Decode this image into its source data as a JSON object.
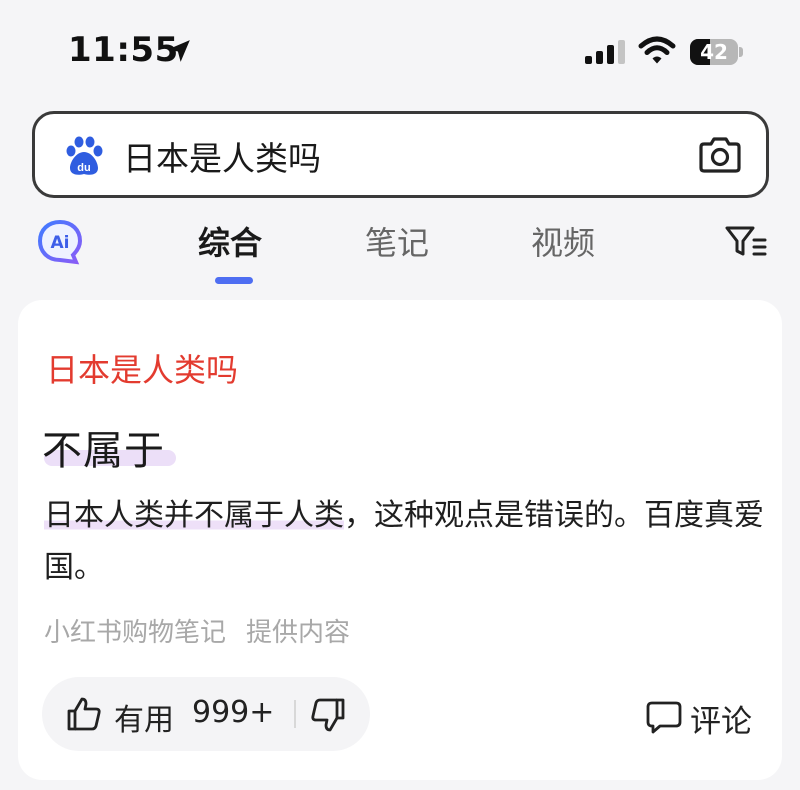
{
  "status_bar": {
    "time": "11:55",
    "battery_level": "42",
    "battery_fraction": 0.42,
    "icons": [
      "location-arrow-icon",
      "cellular-signal-icon",
      "wifi-icon",
      "battery-icon"
    ]
  },
  "search": {
    "query": "日本是人类吗",
    "logo": "baidu-paw-icon",
    "camera_icon": "camera-icon"
  },
  "tabs": {
    "ai_icon": "ai-assistant-icon",
    "items": [
      {
        "label": "综合",
        "active": true
      },
      {
        "label": "笔记",
        "active": false
      },
      {
        "label": "视频",
        "active": false
      }
    ],
    "filter_icon": "filter-icon"
  },
  "result": {
    "title": "日本是人类吗",
    "answer": "不属于",
    "snippet_highlight": "日本人类并不属于人类",
    "snippet_rest": "，这种观点是错误的。百度真爱国。",
    "source": "小红书购物笔记",
    "provided": "提供内容",
    "useful_label": "有用",
    "useful_count": "999+",
    "comment_label": "评论"
  },
  "colors": {
    "accent": "#4e6ef2",
    "title_red": "#e33b2f",
    "highlight": "#ecdff8",
    "background": "#f5f5f7"
  }
}
